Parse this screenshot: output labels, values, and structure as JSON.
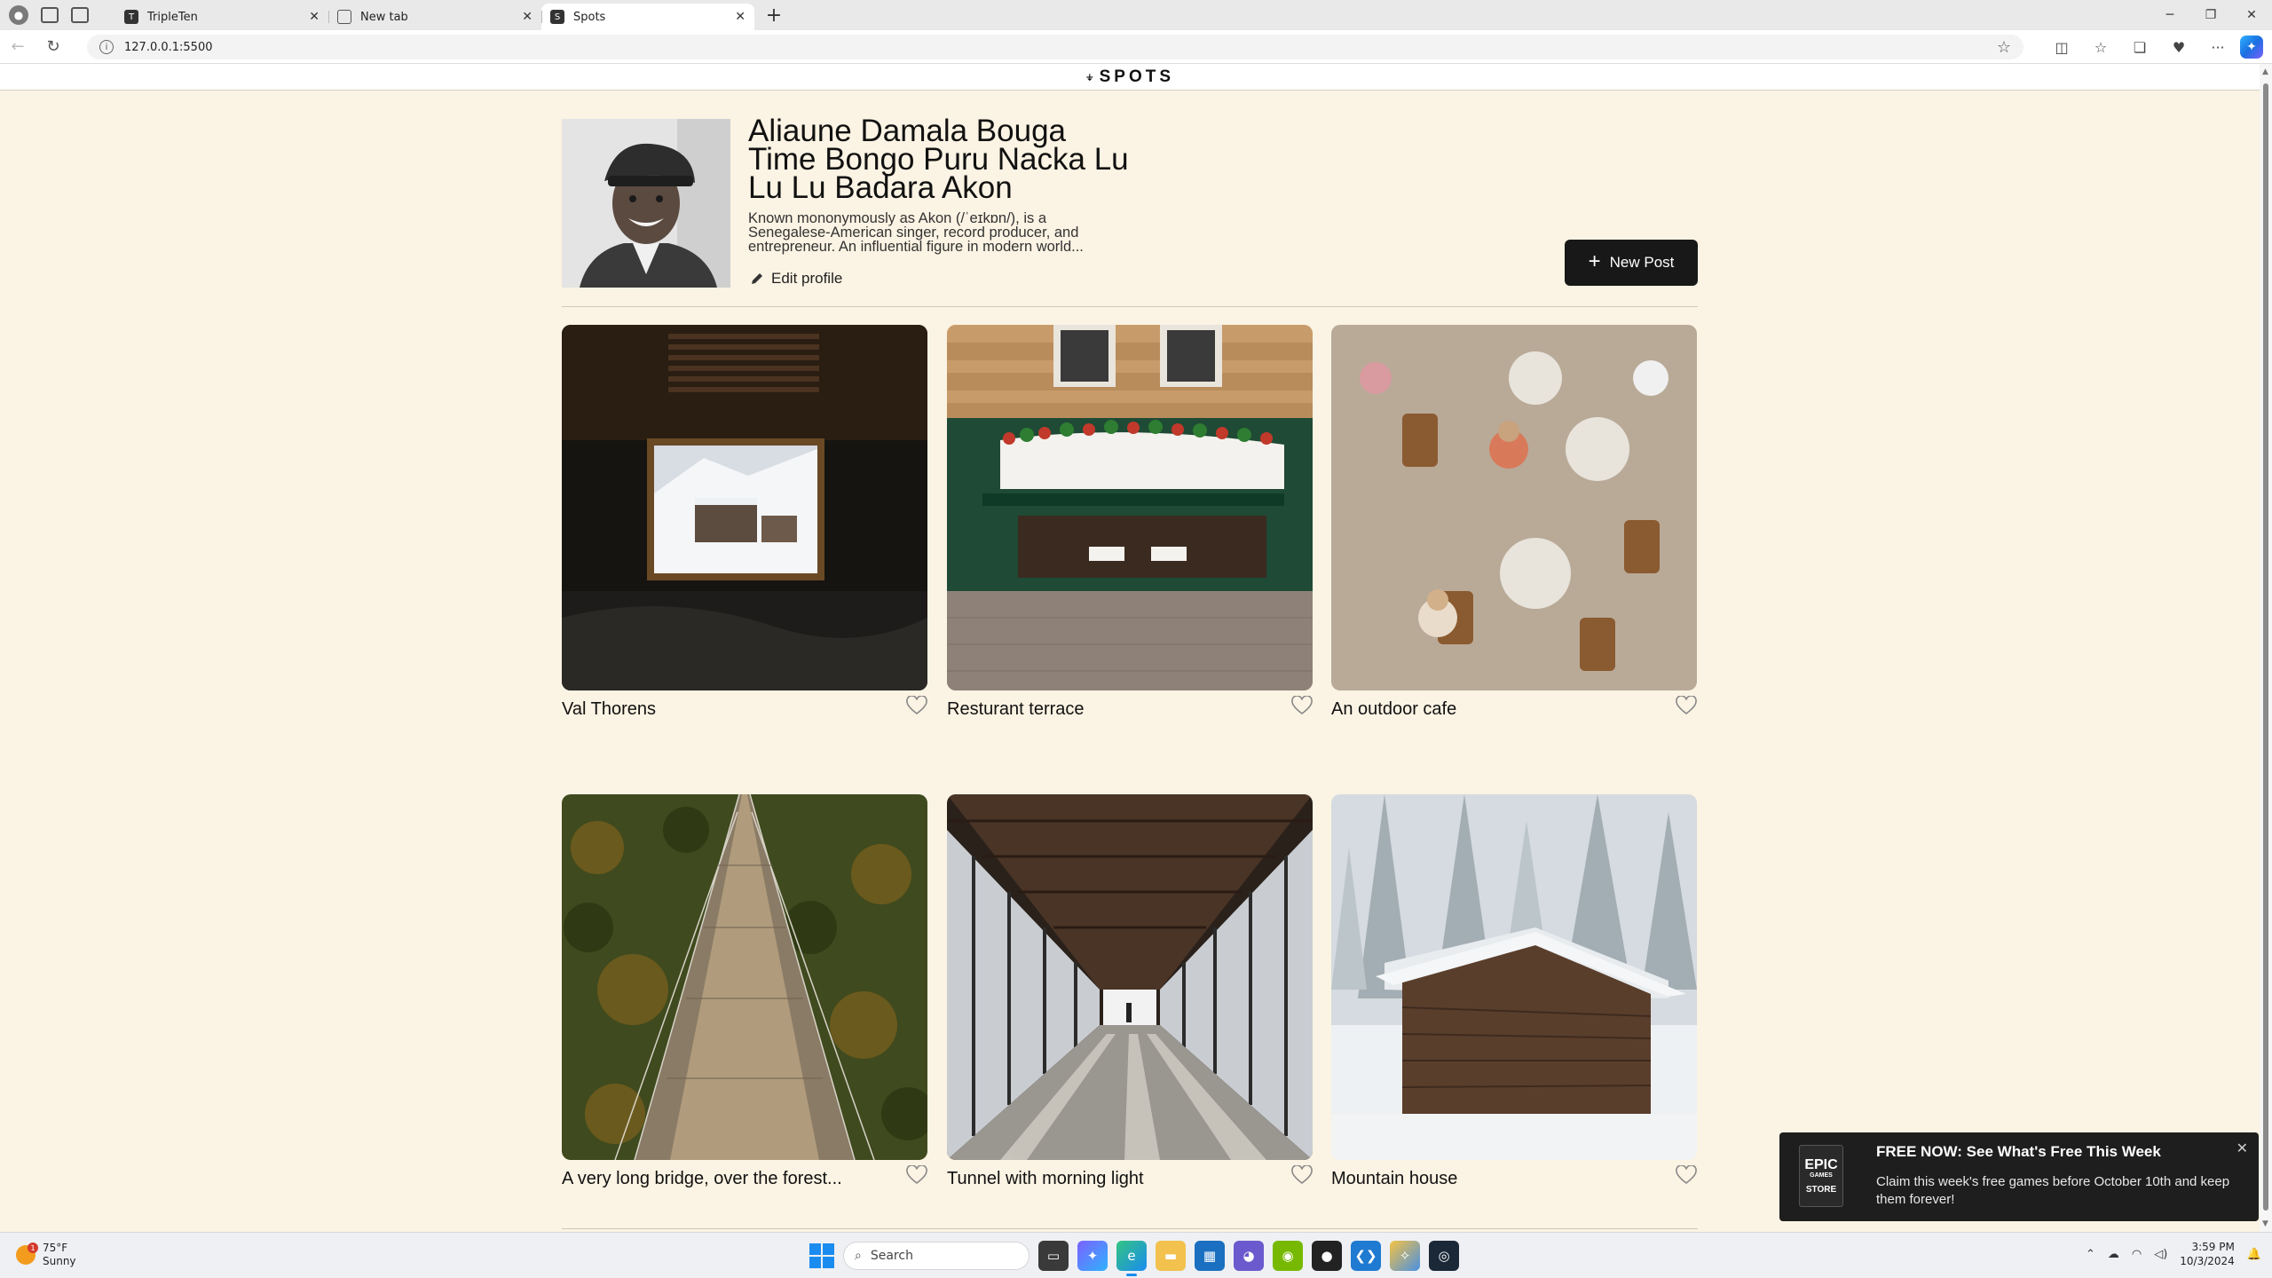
{
  "browser": {
    "tabs": [
      {
        "title": "TripleTen",
        "active": false
      },
      {
        "title": "New tab",
        "active": false
      },
      {
        "title": "Spots",
        "active": true
      }
    ],
    "url": "127.0.0.1:5500"
  },
  "header": {
    "logo": "SPOTS"
  },
  "profile": {
    "name": "Aliaune Damala Bouga Time Bongo Puru Nacka Lu Lu Lu Badara Akon",
    "description": "Known mononymously as Akon (/ˈeɪkɒn/), is a Senegalese-American singer, record producer, and entrepreneur. An influential figure in modern world...",
    "edit_label": "Edit profile",
    "new_post_label": "New Post"
  },
  "cards": [
    {
      "title": "Val Thorens",
      "liked": false
    },
    {
      "title": "Resturant terrace",
      "liked": false
    },
    {
      "title": "An outdoor cafe",
      "liked": false
    },
    {
      "title": "A very long bridge, over the forest...",
      "liked": false
    },
    {
      "title": "Tunnel with morning light",
      "liked": false
    },
    {
      "title": "Mountain house",
      "liked": false
    }
  ],
  "toast": {
    "brand_line1": "EPIC",
    "brand_line2": "GAMES",
    "brand_line3": "STORE",
    "title": "FREE NOW: See What's Free This Week",
    "body": "Claim this week's free games before October 10th and keep them forever!"
  },
  "taskbar": {
    "weather_temp": "75°F",
    "weather_desc": "Sunny",
    "weather_badge": "1",
    "search_placeholder": "Search",
    "time": "3:59 PM",
    "date": "10/3/2024"
  },
  "colors": {
    "page_bg": "#fbf3e3",
    "button_dark": "#181818",
    "accent": "#1a8cf0"
  }
}
